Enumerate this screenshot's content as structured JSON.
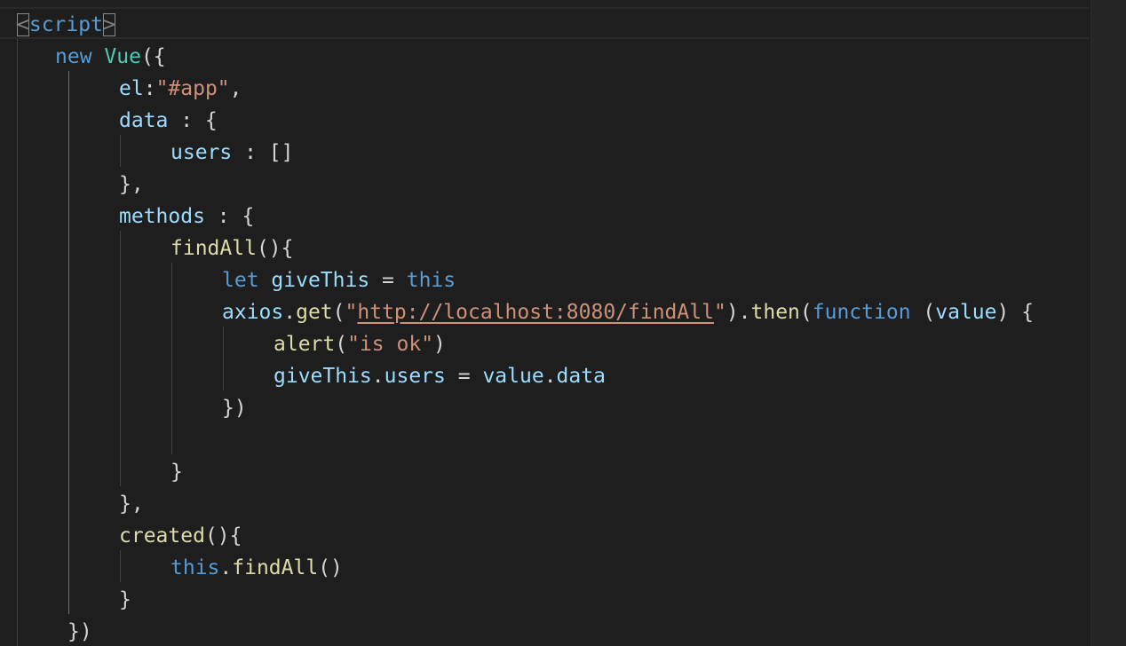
{
  "editor": {
    "lines": [
      {
        "tokens": [
          {
            "t": "<",
            "c": "tag-bracket"
          },
          {
            "t": "script",
            "c": "kw"
          },
          {
            "t": ">",
            "c": "tag-bracket"
          }
        ]
      },
      {
        "tokens": [
          {
            "t": "new",
            "c": "kw"
          },
          {
            "t": " ",
            "c": "pun"
          },
          {
            "t": "Vue",
            "c": "cls"
          },
          {
            "t": "({",
            "c": "pun"
          }
        ]
      },
      {
        "tokens": [
          {
            "t": "el",
            "c": "prop"
          },
          {
            "t": ":",
            "c": "pun"
          },
          {
            "t": "\"#app\"",
            "c": "str"
          },
          {
            "t": ",",
            "c": "pun"
          }
        ]
      },
      {
        "tokens": [
          {
            "t": "data",
            "c": "prop"
          },
          {
            "t": " : {",
            "c": "pun"
          }
        ]
      },
      {
        "tokens": [
          {
            "t": "users",
            "c": "prop"
          },
          {
            "t": " : []",
            "c": "pun"
          }
        ]
      },
      {
        "tokens": [
          {
            "t": "},",
            "c": "pun"
          }
        ]
      },
      {
        "tokens": [
          {
            "t": "methods",
            "c": "prop"
          },
          {
            "t": " : {",
            "c": "pun"
          }
        ]
      },
      {
        "tokens": [
          {
            "t": "findAll",
            "c": "fn"
          },
          {
            "t": "(){",
            "c": "pun"
          }
        ]
      },
      {
        "tokens": [
          {
            "t": "let",
            "c": "kw"
          },
          {
            "t": " ",
            "c": "pun"
          },
          {
            "t": "giveThis",
            "c": "prop"
          },
          {
            "t": " = ",
            "c": "pun"
          },
          {
            "t": "this",
            "c": "kw"
          }
        ]
      },
      {
        "tokens": [
          {
            "t": "axios",
            "c": "prop"
          },
          {
            "t": ".",
            "c": "pun"
          },
          {
            "t": "get",
            "c": "fn"
          },
          {
            "t": "(",
            "c": "pun"
          },
          {
            "t": "\"",
            "c": "str"
          },
          {
            "t": "http://localhost:8080/findAll",
            "c": "url"
          },
          {
            "t": "\"",
            "c": "str"
          },
          {
            "t": ").",
            "c": "pun"
          },
          {
            "t": "then",
            "c": "fn"
          },
          {
            "t": "(",
            "c": "pun"
          },
          {
            "t": "function",
            "c": "kw"
          },
          {
            "t": " (",
            "c": "pun"
          },
          {
            "t": "value",
            "c": "prop"
          },
          {
            "t": ") {",
            "c": "pun"
          }
        ]
      },
      {
        "tokens": [
          {
            "t": "alert",
            "c": "fn"
          },
          {
            "t": "(",
            "c": "pun"
          },
          {
            "t": "\"is ok\"",
            "c": "str"
          },
          {
            "t": ")",
            "c": "pun"
          }
        ]
      },
      {
        "tokens": [
          {
            "t": "giveThis",
            "c": "prop"
          },
          {
            "t": ".",
            "c": "pun"
          },
          {
            "t": "users",
            "c": "prop"
          },
          {
            "t": " = ",
            "c": "pun"
          },
          {
            "t": "value",
            "c": "prop"
          },
          {
            "t": ".",
            "c": "pun"
          },
          {
            "t": "data",
            "c": "prop"
          }
        ]
      },
      {
        "tokens": [
          {
            "t": "})",
            "c": "pun"
          }
        ]
      },
      {
        "tokens": []
      },
      {
        "tokens": [
          {
            "t": "}",
            "c": "pun"
          }
        ]
      },
      {
        "tokens": [
          {
            "t": "},",
            "c": "pun"
          }
        ]
      },
      {
        "tokens": [
          {
            "t": "created",
            "c": "fn"
          },
          {
            "t": "(){",
            "c": "pun"
          }
        ]
      },
      {
        "tokens": [
          {
            "t": "this",
            "c": "kw"
          },
          {
            "t": ".",
            "c": "pun"
          },
          {
            "t": "findAll",
            "c": "fn"
          },
          {
            "t": "()",
            "c": "pun"
          }
        ]
      },
      {
        "tokens": [
          {
            "t": "}",
            "c": "pun"
          }
        ]
      },
      {
        "tokens": [
          {
            "t": "})",
            "c": "pun"
          }
        ]
      }
    ]
  }
}
